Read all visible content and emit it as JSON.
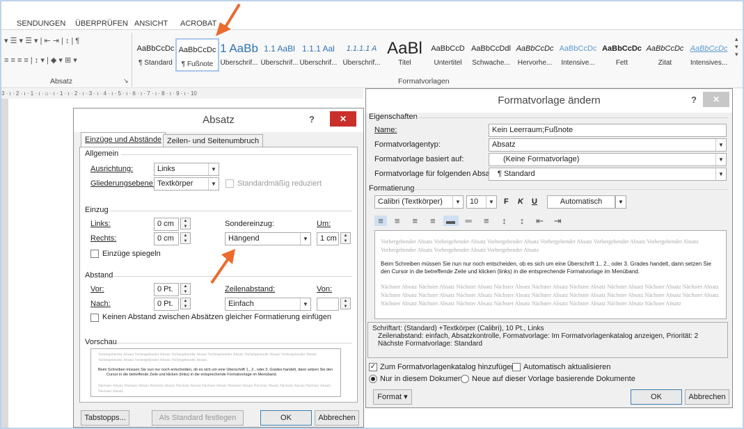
{
  "ribbon": {
    "tabs": [
      "SENDUNGEN",
      "ÜBERPRÜFEN",
      "ANSICHT",
      "ACROBAT"
    ],
    "paragraph_group_label": "Absatz",
    "styles_group_label": "Formatvorlagen",
    "styles": [
      {
        "preview": "AaBbCcDc",
        "name": "¶ Standard"
      },
      {
        "preview": "AaBbCcDc",
        "name": "¶ Fußnote",
        "selected": true
      },
      {
        "preview": "1 AaBb",
        "name": "Überschrif..."
      },
      {
        "preview": "1.1 AaBl",
        "name": "Überschrif..."
      },
      {
        "preview": "1.1.1 Aal",
        "name": "Überschrif..."
      },
      {
        "preview": "1.1.1.1 A",
        "name": "Überschrif..."
      },
      {
        "preview": "AaBl",
        "name": "Titel"
      },
      {
        "preview": "AaBbCcD",
        "name": "Untertitel"
      },
      {
        "preview": "AaBbCcDdl",
        "name": "Schwache..."
      },
      {
        "preview": "AaBbCcDc",
        "name": "Hervorhe..."
      },
      {
        "preview": "AaBbCcDc",
        "name": "Intensive..."
      },
      {
        "preview": "AaBbCcDc",
        "name": "Fett"
      },
      {
        "preview": "AaBbCcDc",
        "name": "Zitat"
      },
      {
        "preview": "AaBbCcDc",
        "name": "Intensives..."
      }
    ],
    "ruler_text": "3 · ı · 2 · ı · 1 · ı · ⌂ · ı · 1 · ı · 2 · ı · 3 · ı · 4 · ı · 5 · ı · 6 · ı · 7 · ı · 8 · ı · 9 · ı · 10"
  },
  "absatz": {
    "title": "Absatz",
    "help": "?",
    "close": "✕",
    "tab_active": "Einzüge und Abstände",
    "tab_inactive": "Zeilen- und Seitenumbruch",
    "allgemein": "Allgemein",
    "ausrichtung_label": "Ausrichtung:",
    "ausrichtung_value": "Links",
    "gliederung_label": "Gliederungsebene:",
    "gliederung_value": "Textkörper",
    "standard_reduziert": "Standardmäßig reduziert",
    "einzug": "Einzug",
    "links_label": "Links:",
    "links_value": "0 cm",
    "rechts_label": "Rechts:",
    "rechts_value": "0 cm",
    "sondereinzug_label": "Sondereinzug:",
    "sondereinzug_value": "Hängend",
    "um_label": "Um:",
    "um_value": "1 cm",
    "spiegeln": "Einzüge spiegeln",
    "abstand": "Abstand",
    "vor_label": "Vor:",
    "vor_value": "0 Pt.",
    "nach_label": "Nach:",
    "nach_value": "0 Pt.",
    "zeilenabstand_label": "Zeilenabstand:",
    "zeilenabstand_value": "Einfach",
    "von_label": "Von:",
    "keinen_abstand": "Keinen Abstand zwischen Absätzen gleicher Formatierung einfügen",
    "vorschau": "Vorschau",
    "preview_before": "Vorhergehender Absatz Vorhergehender Absatz Vorhergehender Absatz Vorhergehender Absatz Vorhergehender Absatz Vorhergehender Absatz Vorhergehender Absatz Vorhergehender Absatz Vorhergehender Absatz",
    "preview_main": "Beim Schreiben müssen Sie nun nur noch entscheiden, ob es sich um eine Überschrift 1., 2., oder 3. Grades handelt, dann setzen Sie den Cursor in die betreffende Zeile und klicken (links) in die entsprechende Formatvorlage im Menüband.",
    "preview_after": "Nächster Absatz Nächster Absatz Nächster Absatz Nächster Absatz Nächster Absatz Nächster Absatz Nächster Absatz Nächster Absatz Nächster Absatz Nächster Absatz",
    "tabstopps": "Tabstopps...",
    "als_standard": "Als Standard festlegen",
    "ok": "OK",
    "abbrechen": "Abbrechen"
  },
  "formatvorlage": {
    "title": "Formatvorlage ändern",
    "help": "?",
    "close": "✕",
    "eigenschaften": "Eigenschaften",
    "name_label": "Name:",
    "name_value": "Kein Leerraum;Fußnote",
    "typ_label": "Formatvorlagentyp:",
    "typ_value": "Absatz",
    "basiert_label": "Formatvorlage basiert auf:",
    "basiert_value": "(Keine Formatvorlage)",
    "folgend_label": "Formatvorlage für folgenden Absatz:",
    "folgend_value": "¶  Standard",
    "formatierung": "Formatierung",
    "font": "Calibri (Textkörper)",
    "size": "10",
    "bold": "F",
    "italic": "K",
    "underline": "U",
    "color": "Automatisch",
    "preview_before": "Vorhergehender Absatz Vorhergehender Absatz Vorhergehender Absatz Vorhergehender Absatz Vorhergehender Absatz Vorhergehender Absatz Vorhergehender Absatz Vorhergehender Absatz Vorhergehender Absatz",
    "preview_main": "Beim Schreiben müssen Sie nun nur noch entscheiden, ob es sich um eine Überschrift 1., 2., oder 3. Grades handelt, dann setzen Sie den Cursor in die betreffende Zeile und klicken (links) in die entsprechende Formatvorlage im Menüband.",
    "preview_after": "Nächster Absatz Nächster Absatz Nächster Absatz Nächster Absatz Nächster Absatz Nächster Absatz Nächster Absatz Nächster Absatz Nächster Absatz Nächster Absatz Nächster Absatz Nächster Absatz Nächster Absatz Nächster Absatz Nächster Absatz Nächster Absatz Nächster Absatz Nächster Absatz Nächster Absatz Nächster Absatz Nächster Absatz Nächster Absatz Nächster Absatz Nächster Absatz Nächster Absatz Nächster Absatz",
    "desc_line1": "Schriftart: (Standard) +Textkörper (Calibri), 10 Pt., Links",
    "desc_line2": "Zeilenabstand:  einfach, Absatzkontrolle, Formatvorlage: Im Formatvorlagenkatalog anzeigen, Priorität: 2",
    "desc_line3": "Nächste Formatvorlage: Standard",
    "katalog": "Zum Formatvorlagenkatalog hinzufügen",
    "auto_update": "Automatisch aktualisieren",
    "nur_dokument": "Nur in diesem Dokument",
    "neue_dokumente": "Neue auf dieser Vorlage basierende Dokumente",
    "format": "Format ▾",
    "ok": "OK",
    "abbrechen": "Abbrechen"
  },
  "colors": {
    "arrow": "#ec6a2c",
    "close_red": "#c9302c",
    "selected_border": "#a7c7ea"
  }
}
